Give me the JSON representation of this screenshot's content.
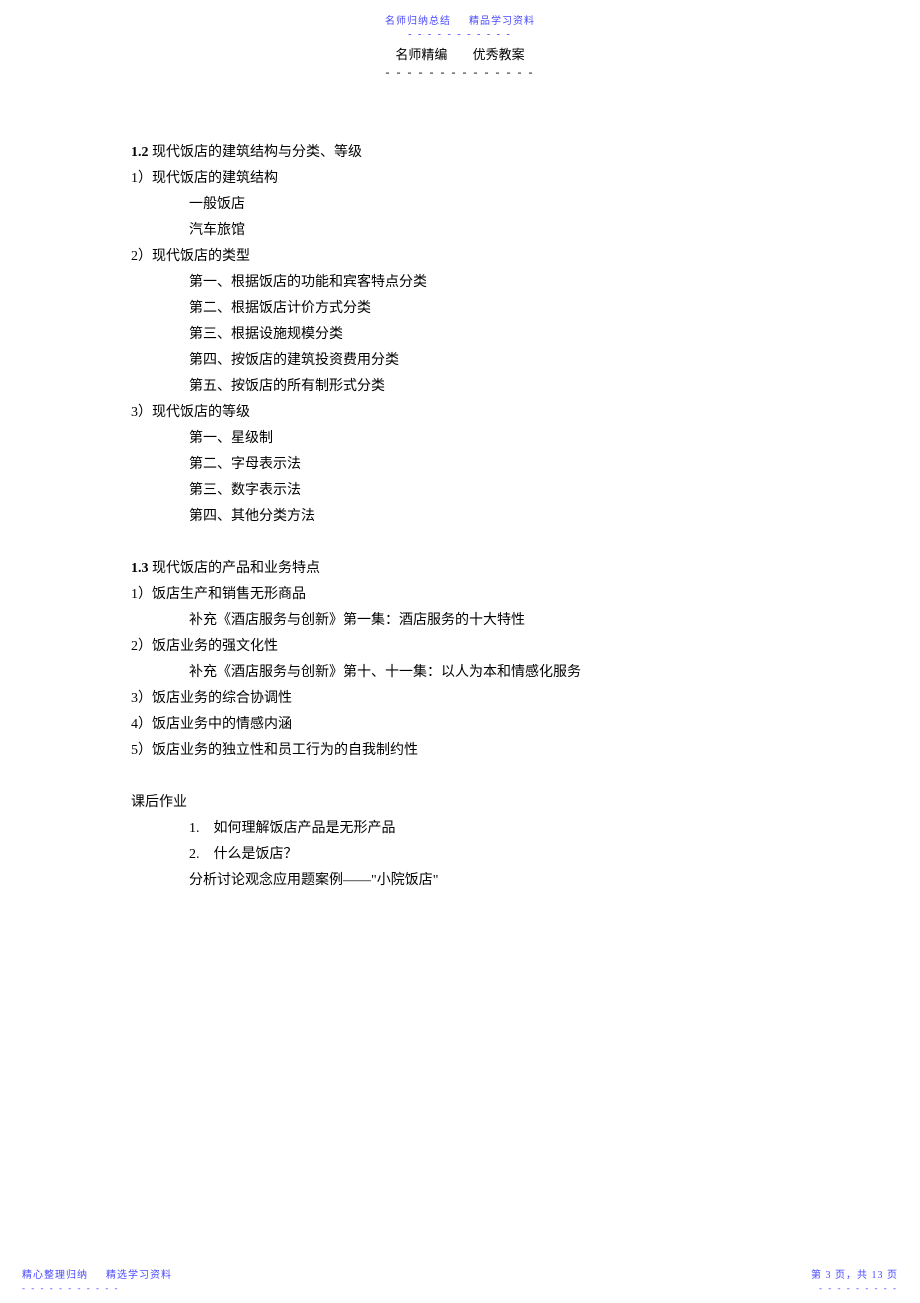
{
  "topHeader": {
    "left": "名师归纳总结",
    "right": "精品学习资料"
  },
  "subHeader": {
    "left": "名师精编",
    "right": "优秀教案"
  },
  "section12": {
    "num": "1.2",
    "title": " 现代饭店的建筑结构与分类、等级",
    "items": [
      "1）现代饭店的建筑结构",
      "一般饭店",
      "汽车旅馆",
      "2）现代饭店的类型",
      "第一、根据饭店的功能和宾客特点分类",
      "第二、根据饭店计价方式分类",
      "第三、根据设施规模分类",
      "第四、按饭店的建筑投资费用分类",
      "第五、按饭店的所有制形式分类",
      "3）现代饭店的等级",
      "第一、星级制",
      "第二、字母表示法",
      "第三、数字表示法",
      "第四、其他分类方法"
    ]
  },
  "section13": {
    "num": "1.3",
    "title": " 现代饭店的产品和业务特点",
    "items": [
      "1）饭店生产和销售无形商品",
      "补充《酒店服务与创新》第一集：酒店服务的十大特性",
      "2）饭店业务的强文化性",
      "补充《酒店服务与创新》第十、十一集：以人为本和情感化服务",
      "3）饭店业务的综合协调性",
      "4）饭店业务中的情感内涵",
      "5）饭店业务的独立性和员工行为的自我制约性"
    ]
  },
  "homework": {
    "title": "课后作业",
    "items": [
      "1.    如何理解饭店产品是无形产品",
      "2.    什么是饭店？",
      "分析讨论观念应用题案例——\"小院饭店\""
    ]
  },
  "footerLeft": {
    "a": "精心整理归纳",
    "b": "精选学习资料"
  },
  "footerRight": {
    "pagePrefix": "第 ",
    "page": "3",
    "pageMid": " 页，共 ",
    "total": "13",
    "pageSuffix": " 页"
  }
}
